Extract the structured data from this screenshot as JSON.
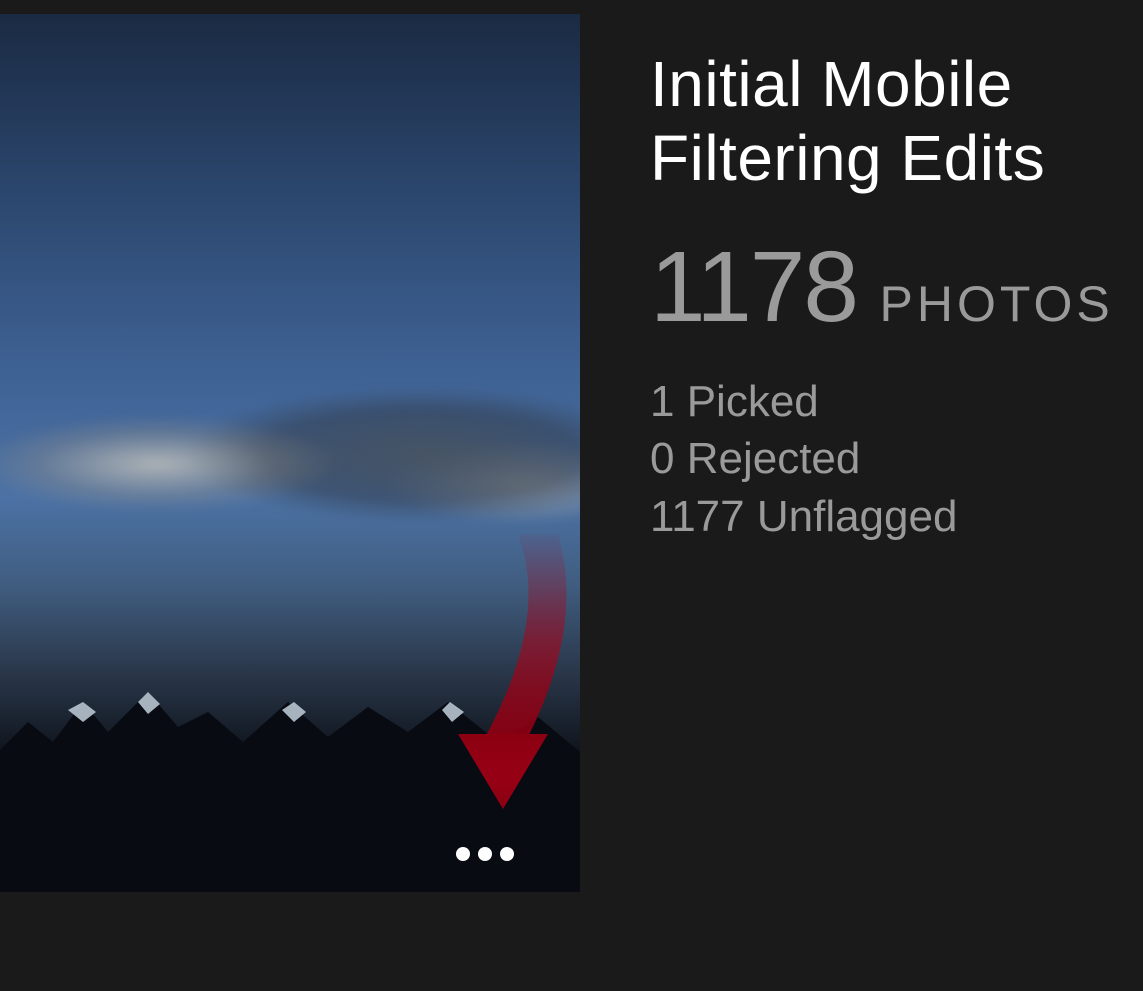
{
  "collection": {
    "title": "Initial Mobile Filtering Edits",
    "photo_count": "1178",
    "photo_label": "PHOTOS",
    "flags": {
      "picked": "1 Picked",
      "rejected": "0 Rejected",
      "unflagged": "1177 Unflagged"
    }
  },
  "icons": {
    "more": "more-options-icon",
    "annotation": "red-arrow-icon"
  },
  "colors": {
    "bg": "#1a1a1a",
    "text_primary": "#ffffff",
    "text_secondary": "#9a9a9a",
    "accent_arrow": "#b00018"
  }
}
